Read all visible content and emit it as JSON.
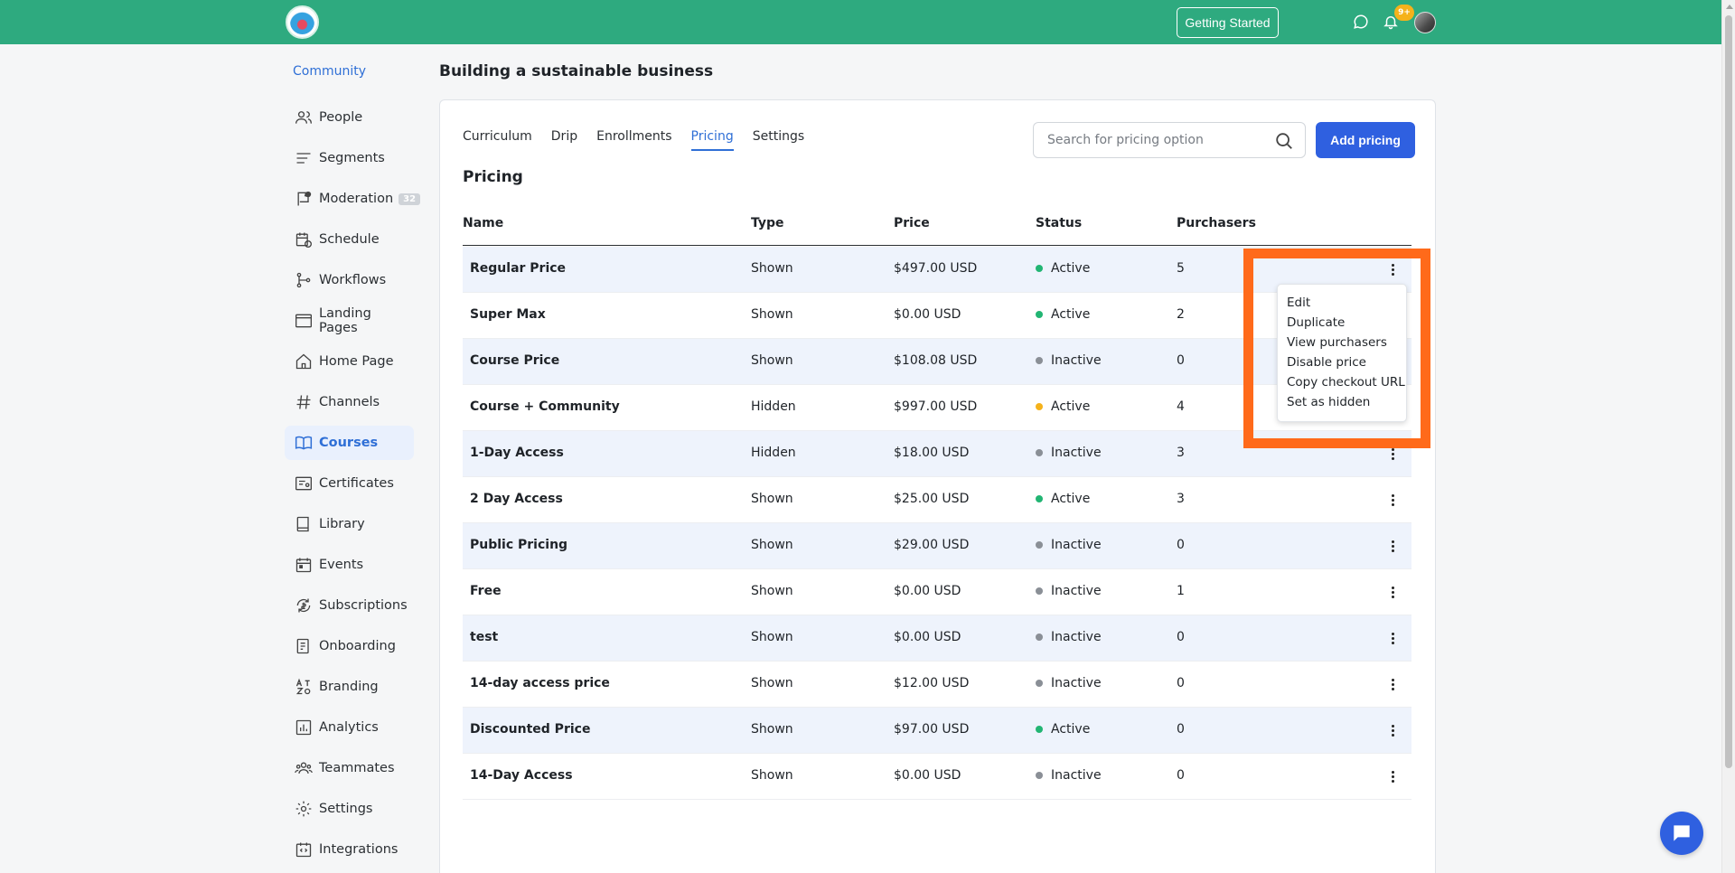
{
  "header": {
    "getting_started_label": "Getting Started",
    "notifications_badge": "9+"
  },
  "sidebar": {
    "community_label": "Community",
    "items": [
      {
        "label": "People",
        "icon": "people-icon"
      },
      {
        "label": "Segments",
        "icon": "segments-icon"
      },
      {
        "label": "Moderation",
        "icon": "moderation-icon",
        "badge": "32"
      },
      {
        "label": "Schedule",
        "icon": "schedule-icon"
      },
      {
        "label": "Workflows",
        "icon": "workflows-icon"
      },
      {
        "label": "Landing Pages",
        "icon": "landing-pages-icon"
      },
      {
        "label": "Home Page",
        "icon": "home-icon"
      },
      {
        "label": "Channels",
        "icon": "hash-icon"
      },
      {
        "label": "Courses",
        "icon": "book-icon",
        "active": true
      },
      {
        "label": "Certificates",
        "icon": "certificate-icon"
      },
      {
        "label": "Library",
        "icon": "library-icon"
      },
      {
        "label": "Events",
        "icon": "calendar-icon"
      },
      {
        "label": "Subscriptions",
        "icon": "subscriptions-icon"
      },
      {
        "label": "Onboarding",
        "icon": "onboarding-icon"
      },
      {
        "label": "Branding",
        "icon": "branding-icon"
      },
      {
        "label": "Analytics",
        "icon": "analytics-icon"
      },
      {
        "label": "Teammates",
        "icon": "teammates-icon"
      },
      {
        "label": "Settings",
        "icon": "gear-icon"
      },
      {
        "label": "Integrations",
        "icon": "integrations-icon"
      }
    ]
  },
  "main": {
    "page_title": "Building a sustainable business",
    "tabs": [
      {
        "label": "Curriculum"
      },
      {
        "label": "Drip"
      },
      {
        "label": "Enrollments"
      },
      {
        "label": "Pricing",
        "active": true
      },
      {
        "label": "Settings"
      }
    ],
    "search_placeholder": "Search for pricing option",
    "add_button_label": "Add pricing",
    "section_title": "Pricing",
    "columns": {
      "name": "Name",
      "type": "Type",
      "price": "Price",
      "status": "Status",
      "purchasers": "Purchasers"
    },
    "rows": [
      {
        "name": "Regular Price",
        "type": "Shown",
        "price": "$497.00 USD",
        "status": "Active",
        "status_color": "#22b573",
        "purchasers": "5"
      },
      {
        "name": "Super Max",
        "type": "Shown",
        "price": "$0.00 USD",
        "status": "Active",
        "status_color": "#22b573",
        "purchasers": "2"
      },
      {
        "name": "Course Price",
        "type": "Shown",
        "price": "$108.08 USD",
        "status": "Inactive",
        "status_color": "#8a8f96",
        "purchasers": "0"
      },
      {
        "name": "Course + Community",
        "type": "Hidden",
        "price": "$997.00 USD",
        "status": "Active",
        "status_color": "#f5b21b",
        "purchasers": "4"
      },
      {
        "name": "1-Day Access",
        "type": "Hidden",
        "price": "$18.00 USD",
        "status": "Inactive",
        "status_color": "#8a8f96",
        "purchasers": "3"
      },
      {
        "name": "2 Day Access",
        "type": "Shown",
        "price": "$25.00 USD",
        "status": "Active",
        "status_color": "#22b573",
        "purchasers": "3"
      },
      {
        "name": "Public Pricing",
        "type": "Shown",
        "price": "$29.00 USD",
        "status": "Inactive",
        "status_color": "#8a8f96",
        "purchasers": "0"
      },
      {
        "name": "Free",
        "type": "Shown",
        "price": "$0.00 USD",
        "status": "Inactive",
        "status_color": "#8a8f96",
        "purchasers": "1"
      },
      {
        "name": "test",
        "type": "Shown",
        "price": "$0.00 USD",
        "status": "Inactive",
        "status_color": "#8a8f96",
        "purchasers": "0"
      },
      {
        "name": "14-day access price",
        "type": "Shown",
        "price": "$12.00 USD",
        "status": "Inactive",
        "status_color": "#8a8f96",
        "purchasers": "0"
      },
      {
        "name": "Discounted Price",
        "type": "Shown",
        "price": "$97.00 USD",
        "status": "Active",
        "status_color": "#22b573",
        "purchasers": "0"
      },
      {
        "name": "14-Day Access",
        "type": "Shown",
        "price": "$0.00 USD",
        "status": "Inactive",
        "status_color": "#8a8f96",
        "purchasers": "0"
      }
    ],
    "context_menu": {
      "items": [
        "Edit",
        "Duplicate",
        "View purchasers",
        "Disable price",
        "Copy checkout URL",
        "Set as hidden"
      ]
    }
  },
  "colors": {
    "brand": "#2eaa7f",
    "accent": "#2f60e0",
    "highlight": "#ff6a1a"
  }
}
